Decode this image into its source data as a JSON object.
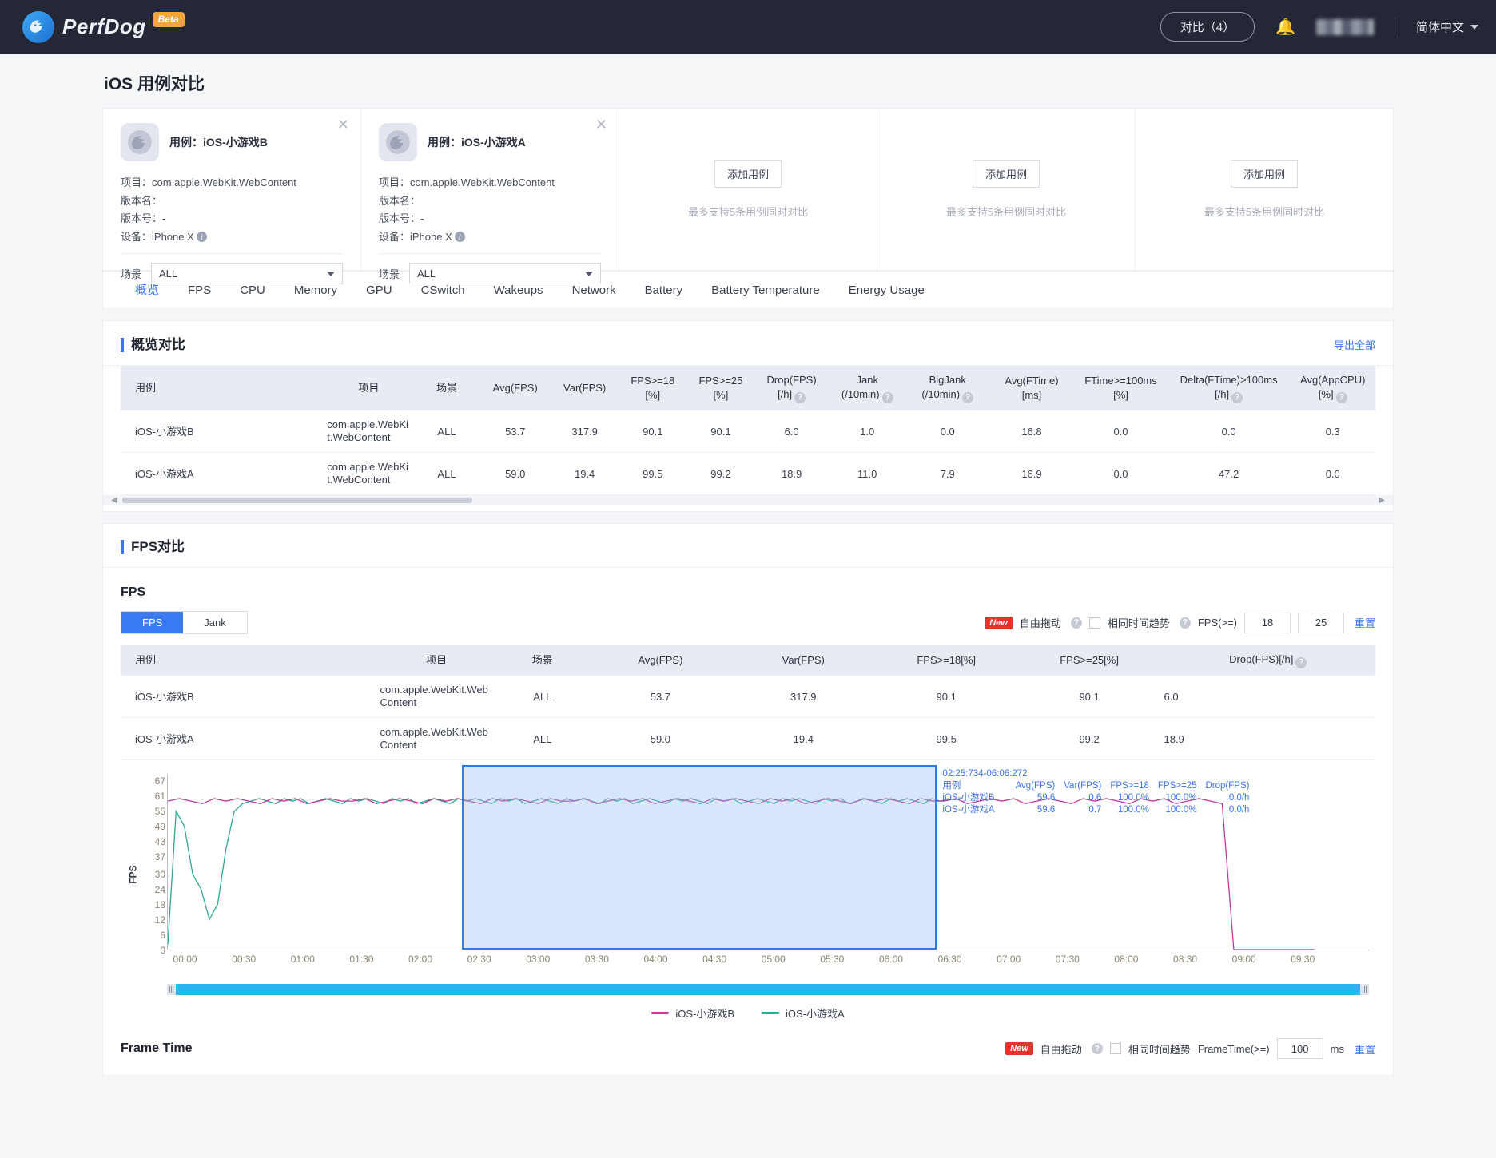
{
  "header": {
    "brand": "PerfDog",
    "beta": "Beta",
    "compare_button": "对比（4）",
    "bell_icon": "bell-icon",
    "language": "简体中文"
  },
  "page": {
    "title": "iOS 用例对比"
  },
  "cases": [
    {
      "title": "用例：iOS-小游戏B",
      "project_label": "项目：",
      "project_value": "com.apple.WebKit.WebContent",
      "version_name_label": "版本名：",
      "version_name_value": "",
      "version_code_label": "版本号：",
      "version_code_value": "-",
      "device_label": "设备：",
      "device_value": "iPhone X",
      "scene_label": "场景",
      "scene_value": "ALL"
    },
    {
      "title": "用例：iOS-小游戏A",
      "project_label": "项目：",
      "project_value": "com.apple.WebKit.WebContent",
      "version_name_label": "版本名：",
      "version_name_value": "",
      "version_code_label": "版本号：",
      "version_code_value": "-",
      "device_label": "设备：",
      "device_value": "iPhone X",
      "scene_label": "场景",
      "scene_value": "ALL"
    }
  ],
  "empty_cards": [
    {
      "add_label": "添加用例",
      "hint": "最多支持5条用例同时对比"
    },
    {
      "add_label": "添加用例",
      "hint": "最多支持5条用例同时对比"
    },
    {
      "add_label": "添加用例",
      "hint": "最多支持5条用例同时对比"
    }
  ],
  "tabs": [
    {
      "label": "概览",
      "active": true
    },
    {
      "label": "FPS",
      "active": false
    },
    {
      "label": "CPU",
      "active": false
    },
    {
      "label": "Memory",
      "active": false
    },
    {
      "label": "GPU",
      "active": false
    },
    {
      "label": "CSwitch",
      "active": false
    },
    {
      "label": "Wakeups",
      "active": false
    },
    {
      "label": "Network",
      "active": false
    },
    {
      "label": "Battery",
      "active": false
    },
    {
      "label": "Battery Temperature",
      "active": false
    },
    {
      "label": "Energy Usage",
      "active": false
    }
  ],
  "overview": {
    "title": "概览对比",
    "export_label": "导出全部",
    "columns": [
      {
        "l1": "用例",
        "l2": "",
        "help": false
      },
      {
        "l1": "项目",
        "l2": "",
        "help": false
      },
      {
        "l1": "场景",
        "l2": "",
        "help": false
      },
      {
        "l1": "Avg(FPS)",
        "l2": "",
        "help": false
      },
      {
        "l1": "Var(FPS)",
        "l2": "",
        "help": false
      },
      {
        "l1": "FPS>=18",
        "l2": "[%]",
        "help": false
      },
      {
        "l1": "FPS>=25",
        "l2": "[%]",
        "help": false
      },
      {
        "l1": "Drop(FPS)",
        "l2": "[/h]",
        "help": true
      },
      {
        "l1": "Jank",
        "l2": "(/10min)",
        "help": true
      },
      {
        "l1": "BigJank",
        "l2": "(/10min)",
        "help": true
      },
      {
        "l1": "Avg(FTime)",
        "l2": "[ms]",
        "help": false
      },
      {
        "l1": "FTime>=100ms",
        "l2": "[%]",
        "help": false
      },
      {
        "l1": "Delta(FTime)>100ms",
        "l2": "[/h]",
        "help": true
      },
      {
        "l1": "Avg(AppCPU)",
        "l2": "[%]",
        "help": true
      }
    ],
    "rows": [
      [
        "iOS-小游戏B",
        "com.apple.WebKit.WebContent",
        "ALL",
        "53.7",
        "317.9",
        "90.1",
        "90.1",
        "6.0",
        "1.0",
        "0.0",
        "16.8",
        "0.0",
        "0.0",
        "0.3"
      ],
      [
        "iOS-小游戏A",
        "com.apple.WebKit.WebContent",
        "ALL",
        "59.0",
        "19.4",
        "99.5",
        "99.2",
        "18.9",
        "11.0",
        "7.9",
        "16.9",
        "0.0",
        "47.2",
        "0.0"
      ]
    ]
  },
  "fps_section": {
    "title": "FPS对比",
    "sub_title": "FPS",
    "segments": [
      {
        "label": "FPS",
        "active": true
      },
      {
        "label": "Jank",
        "active": false
      }
    ],
    "controls": {
      "new_badge": "New",
      "free_drag": "自由拖动",
      "same_time_trend": "相同时间趋势",
      "fps_gte_label": "FPS(>=)",
      "fps_gte_1": "18",
      "fps_gte_2": "25",
      "reset": "重置"
    },
    "columns": [
      "用例",
      "项目",
      "场景",
      "Avg(FPS)",
      "Var(FPS)",
      "FPS>=18[%]",
      "FPS>=25[%]",
      "Drop(FPS)[/h]"
    ],
    "drop_has_help": true,
    "rows": [
      [
        "iOS-小游戏B",
        "com.apple.WebKit.WebContent",
        "ALL",
        "53.7",
        "317.9",
        "90.1",
        "90.1",
        "6.0"
      ],
      [
        "iOS-小游戏A",
        "com.apple.WebKit.WebContent",
        "ALL",
        "59.0",
        "19.4",
        "99.5",
        "99.2",
        "18.9"
      ]
    ],
    "legend": [
      {
        "name": "iOS-小游戏B",
        "color": "#c2379f"
      },
      {
        "name": "iOS-小游戏A",
        "color": "#2ea890"
      }
    ],
    "tooltip": {
      "range": "02:25:734-06:06:272",
      "headers": [
        "用例",
        "Avg(FPS)",
        "Var(FPS)",
        "FPS>=18",
        "FPS>=25",
        "Drop(FPS)"
      ],
      "rows": [
        [
          "iOS-小游戏B",
          "59.6",
          "0.6",
          "100.0%",
          "100.0%",
          "0.0/h"
        ],
        [
          "iOS-小游戏A",
          "59.6",
          "0.7",
          "100.0%",
          "100.0%",
          "0.0/h"
        ]
      ]
    }
  },
  "frame_time": {
    "title": "Frame Time",
    "new_badge": "New",
    "free_drag": "自由拖动",
    "same_time_trend": "相同时间趋势",
    "ft_gte_label": "FrameTime(>=)",
    "ft_value": "100",
    "unit": "ms",
    "reset": "重置"
  },
  "chart_data": {
    "type": "line",
    "title": "FPS",
    "xlabel": "",
    "ylabel": "FPS",
    "ylim": [
      0,
      67
    ],
    "yticks": [
      0,
      6,
      12,
      18,
      24,
      30,
      37,
      43,
      49,
      55,
      61,
      67
    ],
    "xticks": [
      "00:00",
      "00:30",
      "01:00",
      "01:30",
      "02:00",
      "02:30",
      "03:00",
      "03:30",
      "04:00",
      "04:30",
      "05:00",
      "05:30",
      "06:00",
      "06:30",
      "07:00",
      "07:30",
      "08:00",
      "08:30",
      "09:00",
      "09:30"
    ],
    "grid": false,
    "legend_position": "bottom",
    "selection": {
      "start": "02:25",
      "end": "06:06",
      "label": "02:25:734-06:06:272"
    },
    "series": [
      {
        "name": "iOS-小游戏B",
        "color": "#c2379f",
        "avg": 53.7,
        "var": 317.9,
        "note": "flat near 59-60 fps across run, drops to ~0 at 08:55",
        "values": [
          59,
          60,
          59,
          58,
          60,
          59,
          60,
          59,
          58,
          60,
          59,
          60,
          58,
          59,
          60,
          59,
          59,
          60,
          58,
          59,
          60,
          59,
          58,
          60,
          59,
          60,
          59,
          58,
          60,
          59,
          60,
          59,
          58,
          60,
          59,
          59,
          60,
          58,
          59,
          60,
          59,
          60,
          58,
          59,
          60,
          59,
          58,
          60,
          59,
          60,
          59,
          58,
          60,
          59,
          60,
          58,
          59,
          60,
          59,
          58,
          60,
          59,
          60,
          59,
          58,
          60,
          59,
          59,
          60,
          58,
          59,
          60,
          59,
          60,
          58,
          59,
          60,
          59,
          58,
          60,
          59,
          60,
          59,
          58,
          60,
          59,
          60,
          58,
          59,
          60,
          59,
          58,
          0,
          0,
          0,
          0,
          0,
          0,
          0,
          0
        ]
      },
      {
        "name": "iOS-小游戏A",
        "color": "#2ea890",
        "avg": 59.0,
        "var": 19.4,
        "note": "initial spike/dip at start 55->12->30, then steady 58-60, ends at 06:10",
        "values": [
          2,
          55,
          49,
          30,
          24,
          12,
          18,
          40,
          55,
          58,
          59,
          60,
          59,
          58,
          60,
          59,
          60,
          58,
          59,
          60,
          59,
          58,
          60,
          59,
          60,
          59,
          58,
          60,
          59,
          60,
          58,
          59,
          60,
          59,
          58,
          60,
          59,
          60,
          59,
          58,
          60,
          59,
          60,
          58,
          59,
          60,
          59,
          58,
          60,
          59,
          60,
          59,
          58,
          60,
          59,
          60,
          58,
          59,
          60,
          59,
          58,
          60,
          59,
          60,
          59,
          58,
          60,
          59,
          60,
          58,
          59,
          60,
          59,
          58,
          60,
          59,
          60,
          59,
          58,
          60,
          59,
          60,
          58,
          59,
          60,
          59,
          58,
          60,
          59,
          60,
          59,
          58,
          60,
          59,
          60
        ]
      }
    ]
  }
}
